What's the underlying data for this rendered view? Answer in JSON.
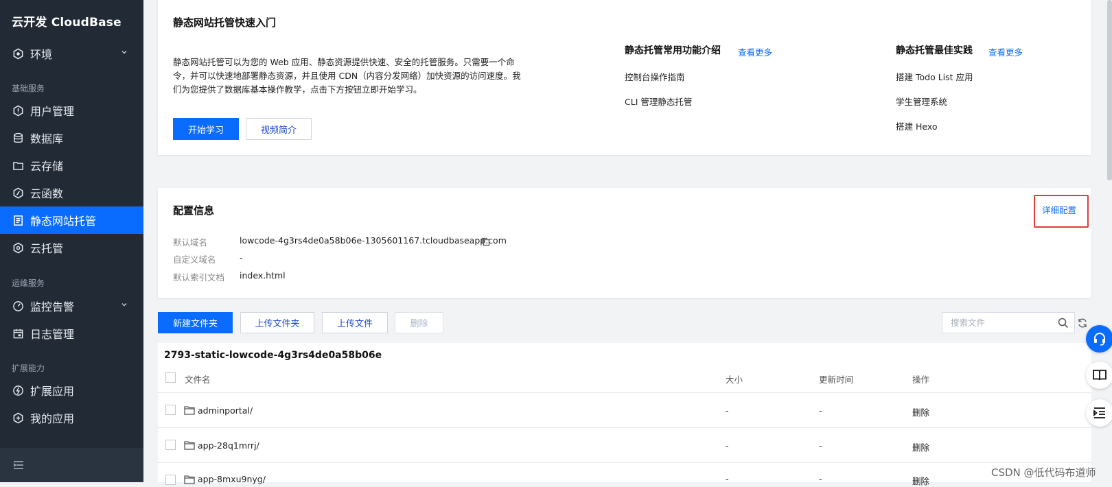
{
  "sidebar": {
    "brand": "云开发 CloudBase",
    "env_label": "环境",
    "group_basic": "基础服务",
    "group_ops": "运维服务",
    "group_ext": "扩展能力",
    "items": {
      "users": "用户管理",
      "database": "数据库",
      "storage": "云存储",
      "functions": "云函数",
      "hosting": "静态网站托管",
      "cloudrun": "云托管",
      "monitor": "监控告警",
      "logs": "日志管理",
      "ext_apps": "扩展应用",
      "my_apps": "我的应用"
    },
    "active": "hosting",
    "accent": "#0a6cff"
  },
  "quickstart": {
    "title": "静态网站托管快速入门",
    "desc_lines": [
      "静态网站托管可以为您的 Web 应用、静态资源提供快速、安全的托管服务。只需要一个命",
      "令，并可以快速地部署静态资源，并且使用 CDN（内容分发网络）加快资源的访问速度。我",
      "们为您提供了数据库基本操作教学，点击下方按钮立即开始学习。"
    ],
    "start_btn": "开始学习",
    "video_btn": "视频简介",
    "features": {
      "title": "静态托管常用功能介绍",
      "more": "查看更多",
      "items": [
        "控制台操作指南",
        "CLI 管理静态托管"
      ]
    },
    "practice": {
      "title": "静态托管最佳实践",
      "more": "查看更多",
      "items": [
        "搭建 Todo List 应用",
        "学生管理系统",
        "搭建 Hexo"
      ]
    }
  },
  "config": {
    "title": "配置信息",
    "detail_link": "详细配置",
    "default_domain_label": "默认域名",
    "default_domain": "lowcode-4g3rs4de0a58b06e-1305601167.tcloudbaseapp.com",
    "custom_domain_label": "自定义域名",
    "custom_domain": "-",
    "index_label": "默认索引文档",
    "index_doc": "index.html"
  },
  "toolbar": {
    "new_folder": "新建文件夹",
    "upload_folder": "上传文件夹",
    "upload_file": "上传文件",
    "delete": "删除",
    "search_placeholder": "搜索文件"
  },
  "files": {
    "bucket": "2793-static-lowcode-4g3rs4de0a58b06e",
    "columns": [
      "文件名",
      "大小",
      "更新时间",
      "操作"
    ],
    "rows": [
      {
        "name": "adminportal/",
        "size": "-",
        "updated": "-",
        "action": "删除"
      },
      {
        "name": "app-28q1mrrj/",
        "size": "-",
        "updated": "-",
        "action": "删除"
      },
      {
        "name": "app-8mxu9nyg/",
        "size": "-",
        "updated": "-",
        "action": "删除"
      }
    ]
  },
  "watermark": "CSDN @低代码布道师"
}
